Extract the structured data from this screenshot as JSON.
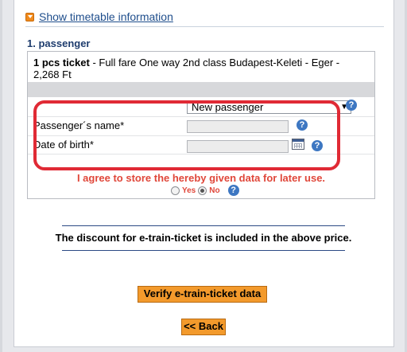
{
  "timetable": {
    "link_text": "Show timetable information"
  },
  "passenger": {
    "section_title": "1. passenger",
    "ticket_bold": "1 pcs ticket",
    "ticket_desc": " - Full fare One way 2nd class Budapest-Keleti - Eger - 2,268 Ft",
    "select_value": "New passenger",
    "name_label": "Passenger´s name*",
    "name_value": "",
    "dob_label": "Date of birth*",
    "dob_value": "",
    "help_glyph": "?",
    "agree_text": "I agree to store the hereby given data for later use.",
    "radio_yes": "Yes",
    "radio_no": "No",
    "radio_selected": "No"
  },
  "discount_note": "The discount for e-train-ticket is included in the above price.",
  "buttons": {
    "verify_label": "Verify e-train-ticket data",
    "back_label": "<< Back"
  },
  "colors": {
    "accent_orange": "#f39a2c",
    "link_blue": "#1f4e8c",
    "highlight_red": "#e02a35",
    "agree_red": "#e0473a"
  },
  "icons": [
    "expand-icon",
    "help-icon",
    "calendar-icon",
    "dropdown-arrow-icon"
  ]
}
